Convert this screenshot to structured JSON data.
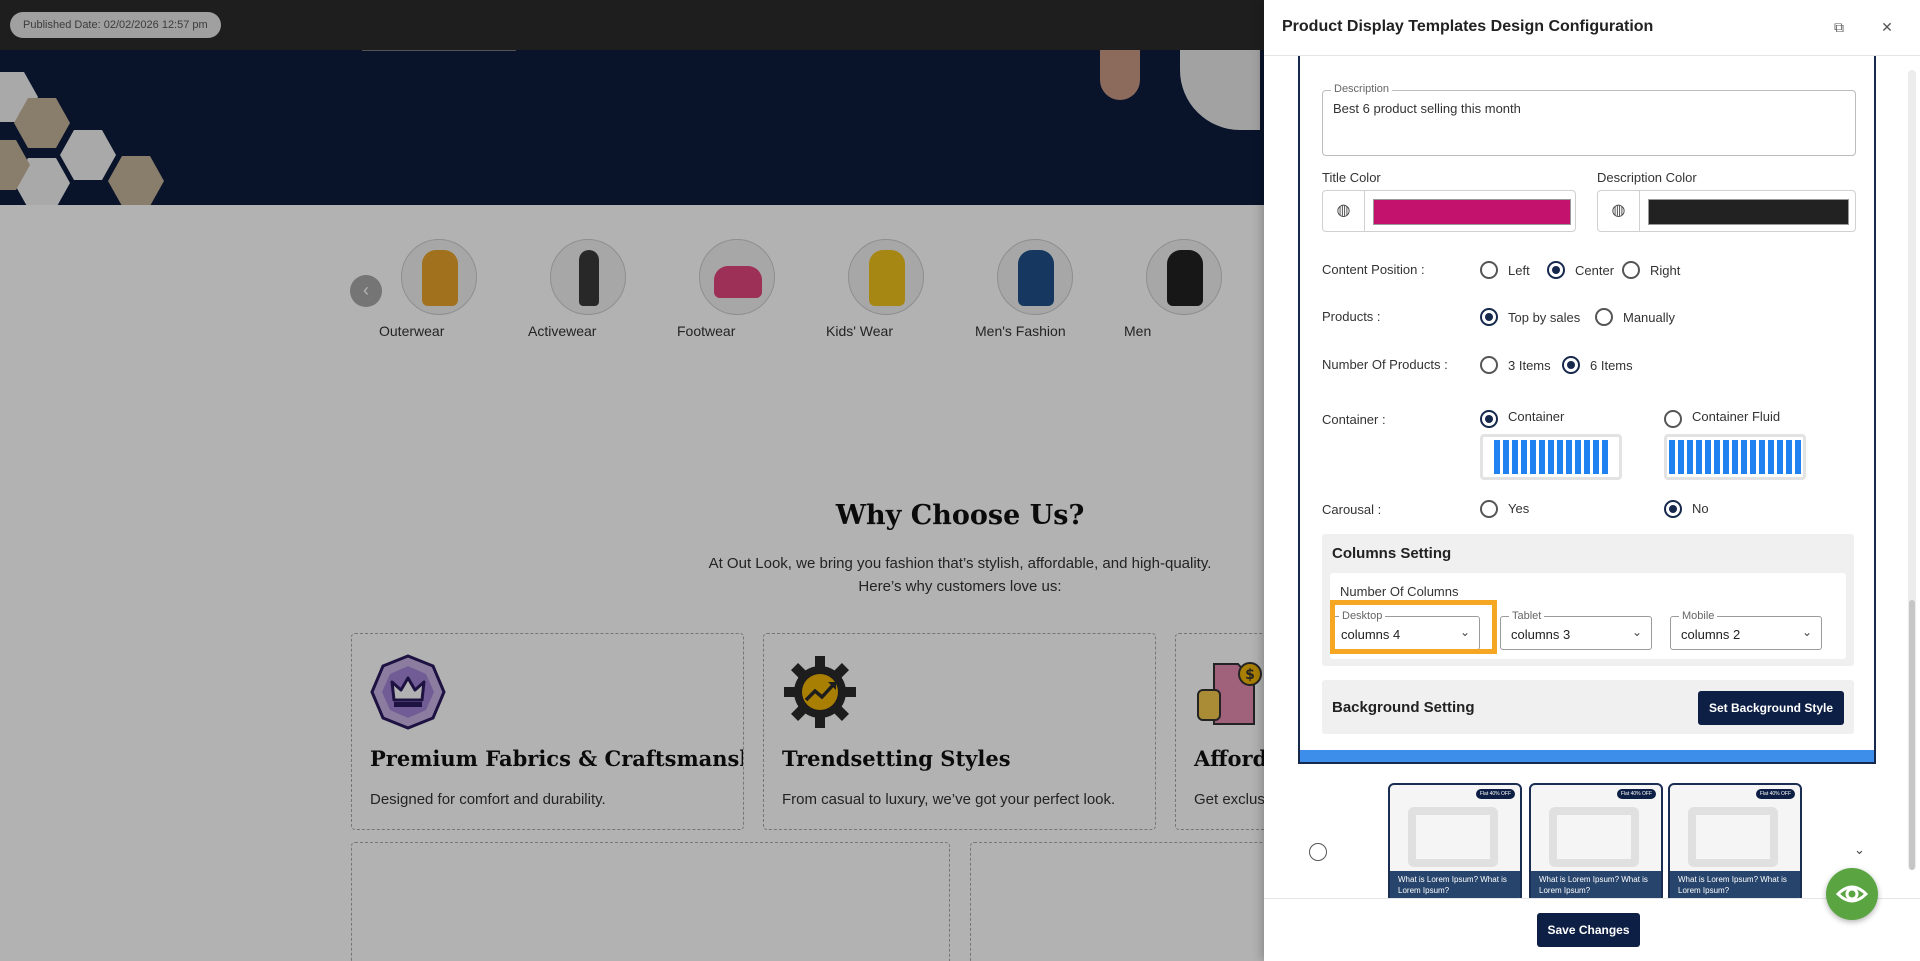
{
  "site": {
    "published_date": "Published Date: 02/02/2026 12:57 pm",
    "categories": [
      {
        "label": "Outerwear",
        "color": "#e7a22a"
      },
      {
        "label": "Activewear",
        "color": "#3a3a3a"
      },
      {
        "label": "Footwear",
        "color": "#e0457b"
      },
      {
        "label": "Kids' Wear",
        "color": "#f0c21d"
      },
      {
        "label": "Men's Fashion",
        "color": "#1f4f8a"
      },
      {
        "label": "Men",
        "color": "#222222"
      }
    ],
    "why_title": "Why Choose Us?",
    "why_line1": "At Out Look, we bring you fashion that’s stylish, affordable, and high-quality.",
    "why_line2": "Here’s why customers love us:",
    "features": [
      {
        "title": "Premium Fabrics & Craftsmanship",
        "desc": "Designed for comfort and durability.",
        "icon": "crown-icon"
      },
      {
        "title": "Trendsetting Styles",
        "desc": "From casual to luxury, we’ve got your perfect look.",
        "icon": "gear-trend-icon"
      },
      {
        "title": "Afforda",
        "desc": "Get exclus",
        "icon": "price-tag-icon"
      }
    ]
  },
  "panel": {
    "title": "Product Display Templates Design Configuration",
    "description": {
      "legend": "Description",
      "value": "Best 6 product selling this month"
    },
    "title_color": {
      "label": "Title Color",
      "value": "#c2126e"
    },
    "description_color": {
      "label": "Description Color",
      "value": "#222222"
    },
    "content_position": {
      "label": "Content Position :",
      "options": [
        "Left",
        "Center",
        "Right"
      ],
      "selected": "Center"
    },
    "products": {
      "label": "Products :",
      "options": [
        "Top by sales",
        "Manually"
      ],
      "selected": "Top by sales"
    },
    "number_of_products": {
      "label": "Number Of Products :",
      "options": [
        "3 Items",
        "6 Items"
      ],
      "selected": "6 Items"
    },
    "container": {
      "label": "Container :",
      "options": [
        "Container",
        "Container Fluid"
      ],
      "selected": "Container"
    },
    "carousal": {
      "label": "Carousal :",
      "options": [
        "Yes",
        "No"
      ],
      "selected": "No"
    },
    "columns_setting": {
      "title": "Columns Setting",
      "number_of_columns": "Number Of Columns",
      "desktop": {
        "legend": "Desktop",
        "value": "columns 4"
      },
      "tablet": {
        "legend": "Tablet",
        "value": "columns 3"
      },
      "mobile": {
        "legend": "Mobile",
        "value": "columns 2"
      }
    },
    "background_setting": {
      "title": "Background Setting",
      "button": "Set Background Style"
    },
    "template_cards": [
      {
        "badge": "Flat 40% OFF",
        "caption": "What is Lorem Ipsum? What is Lorem Ipsum?"
      },
      {
        "badge": "Flat 40% OFF",
        "caption": "What is Lorem Ipsum? What is Lorem Ipsum?"
      },
      {
        "badge": "Flat 40% OFF",
        "caption": "What is Lorem Ipsum? What is Lorem Ipsum?"
      }
    ],
    "save_button": "Save Changes"
  },
  "colors": {
    "navy": "#0d1f44",
    "accent_blue": "#3d8eea",
    "highlight": "#f5a623",
    "preview_green": "#5aa542"
  }
}
